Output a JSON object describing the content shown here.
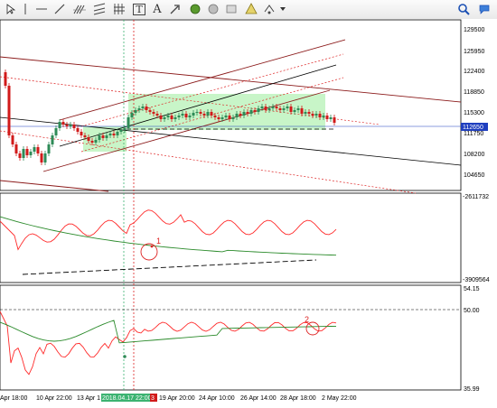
{
  "toolbar": {
    "tools": [
      {
        "icon": "cursor-icon"
      },
      {
        "icon": "vertical-line-icon"
      },
      {
        "icon": "horizontal-line-icon"
      },
      {
        "icon": "trendline-icon"
      },
      {
        "icon": "fibonacci-icon"
      },
      {
        "icon": "parallel-channel-icon"
      },
      {
        "icon": "gann-grid-icon"
      },
      {
        "icon": "text-tool-icon",
        "glyph": "T"
      },
      {
        "icon": "text-label-icon",
        "glyph": "A"
      },
      {
        "icon": "arrow-icon"
      },
      {
        "icon": "ellipse-icon"
      },
      {
        "icon": "rectangle-icon"
      },
      {
        "icon": "triangle-icon"
      },
      {
        "icon": "more-objects-icon"
      }
    ],
    "right_icons": [
      "search-icon",
      "community-icon"
    ]
  },
  "price_axis": {
    "labels": [
      "129500",
      "125950",
      "122400",
      "118850",
      "115300",
      "111750",
      "108200",
      "104650"
    ],
    "current_price": "112650"
  },
  "indicator1_axis": {
    "labels": [
      "-2611732",
      "-3909564"
    ]
  },
  "indicator2_axis": {
    "labels": [
      "54.15",
      "50.00",
      "35.99"
    ]
  },
  "time_axis": {
    "labels": [
      "Apr 18:00",
      "10 Apr 22:00",
      "13 Apr 1",
      "2018.04.17 22:00",
      "19 Apr 20:00",
      "24 Apr 10:00",
      "26 Apr 14:00",
      "28 Apr 18:00",
      "2 May 22:00"
    ],
    "highlight_marker": "3"
  },
  "annotations": {
    "marker1": "1",
    "marker2": "2"
  },
  "colors": {
    "candle_up": "#2e8b57",
    "candle_down": "#d11a1a",
    "channel_fill": "#c8f5c8",
    "osc_line": "#ff2a2a",
    "ma_line": "#2a8a2a",
    "highlight": "#3cb371",
    "price_tag": "#1f3fbf"
  }
}
